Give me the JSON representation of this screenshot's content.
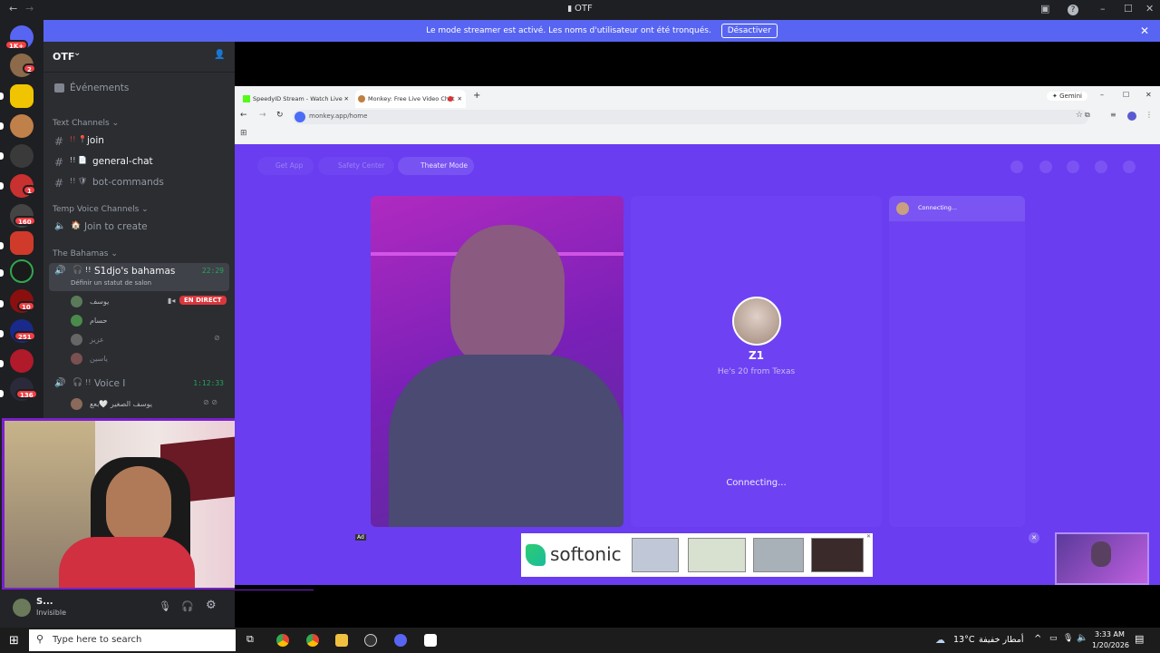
{
  "window": {
    "title": "OTF",
    "nav_back": "←",
    "nav_fwd": "→",
    "btn_inbox": "▣",
    "btn_help": "?",
    "btn_min": "–",
    "btn_max": "☐",
    "btn_close": "✕"
  },
  "banner": {
    "text": "Le mode streamer est activé. Les noms d'utilisateur ont été tronqués.",
    "button": "Désactiver",
    "close": "✕"
  },
  "servers": [
    {
      "badge": "1K+",
      "color": "#5865f2"
    },
    {
      "badge": "2",
      "color": "#8c6a4a"
    },
    {
      "badge": "",
      "color": "#f0c400"
    },
    {
      "badge": "",
      "color": "#c0804a"
    },
    {
      "badge": "",
      "color": "#3a3a3a"
    },
    {
      "badge": "1",
      "color": "#c93030"
    },
    {
      "badge": "160",
      "color": "#444"
    },
    {
      "badge": "",
      "color": "#d03a2a"
    },
    {
      "badge": "",
      "color": "#1a1a1a"
    },
    {
      "badge": "10",
      "color": "#8a1010"
    },
    {
      "badge": "251",
      "color": "#1a2a8a"
    },
    {
      "badge": "",
      "color": "#b01a2a"
    },
    {
      "badge": "136",
      "color": "#2a2a3a"
    }
  ],
  "sidebar": {
    "server_name": "OTF",
    "chevron": "⌄",
    "invite_icon": "👤",
    "events": "Événements",
    "text_category": "Text Channels",
    "text_channels": [
      {
        "name": "join",
        "prefix": "#",
        "decor": "!! 📍"
      },
      {
        "name": "general-chat",
        "prefix": "#",
        "decor": "!! 📄"
      },
      {
        "name": "bot-commands",
        "prefix": "#",
        "decor": "!! 🛡"
      }
    ],
    "temp_category": "Temp Voice Channels",
    "temp_channel": "Join to create",
    "temp_decor": "🏠",
    "bahamas_category": "The Bahamas",
    "voice1": {
      "name": "S1djo's bahamas",
      "decor": "!!",
      "time": "22:29",
      "status": "Définir un statut de salon"
    },
    "voice1_users": [
      {
        "name": "يوسف",
        "live": "EN DIRECT"
      },
      {
        "name": "حسام",
        "live": ""
      },
      {
        "name": "عزيز",
        "live": ""
      },
      {
        "name": "ياسين",
        "live": ""
      }
    ],
    "voice2": {
      "name": "Voice I",
      "decor": "!!",
      "time": "1:12:33"
    },
    "voice2_users": [
      {
        "name": "يوسف الصغير 🤍بعع"
      }
    ]
  },
  "userpanel": {
    "name": "S...",
    "status": "Invisible",
    "mic": "🎙",
    "headset": "🎧",
    "settings": "⚙"
  },
  "browser": {
    "tabs": [
      {
        "label": "SpeedyID Stream - Watch Live",
        "favicon_color": "#53fc18"
      },
      {
        "label": "Monkey: Free Live Video Chat",
        "favicon_color": "#c08040"
      }
    ],
    "new_tab": "+",
    "gemini": "Gemini",
    "url": "monkey.app/home",
    "reload": "↻",
    "back": "←",
    "fwd": "→",
    "star": "☆",
    "apps": "⊞"
  },
  "monkey": {
    "nav": [
      {
        "label": "Get App"
      },
      {
        "label": "Safety Center"
      },
      {
        "label": "Theater Mode"
      }
    ],
    "chat_status": "Connecting...",
    "profile": {
      "name": "Z1",
      "desc": "He's 20 from Texas"
    },
    "connecting": "Connecting...",
    "ad_label": "Ad",
    "ad_brand": "softonic",
    "ad_close": "✕"
  },
  "taskbar": {
    "search": "Type here to search",
    "weather_temp": "13°C",
    "weather_text": "أمطار خفيفة",
    "time": "3:33 AM",
    "date": "1/20/2026",
    "tray_up": "^"
  }
}
